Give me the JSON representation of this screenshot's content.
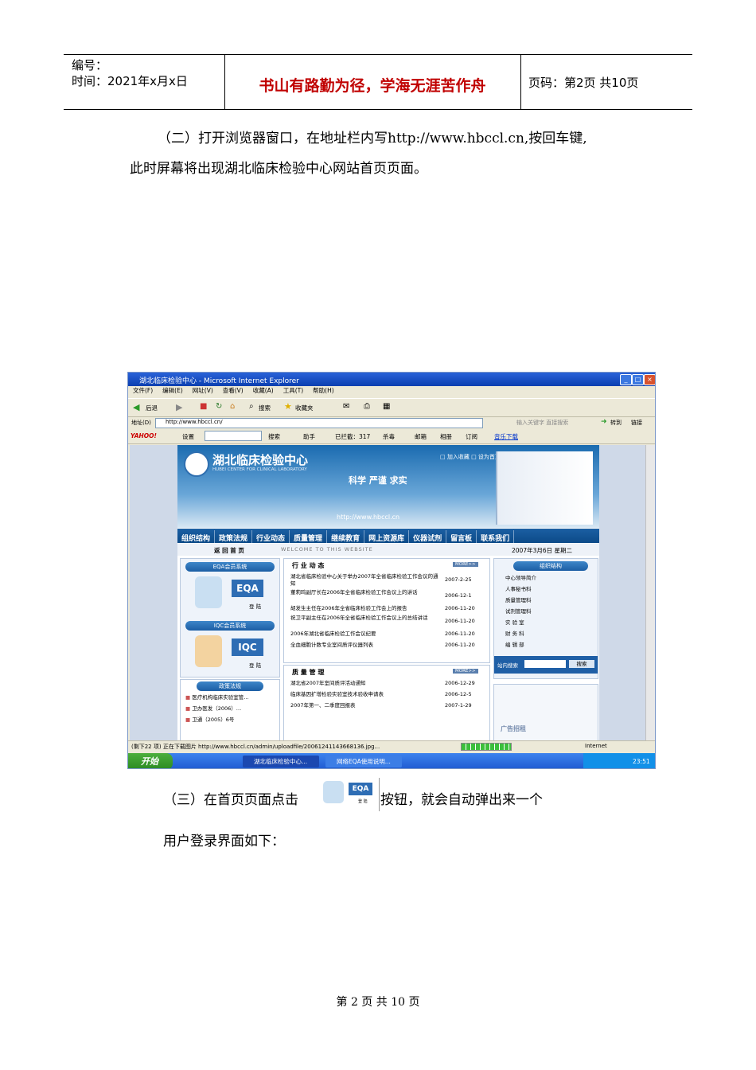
{
  "header": {
    "code_label": "编号：",
    "date_label": "时间：2021年x月x日",
    "motto": "书山有路勤为径，学海无涯苦作舟",
    "page_label": "页码：第2页  共10页"
  },
  "paragraphs": {
    "p1_line1": "（二）打开浏览器窗口，在地址栏内写http://www.hbccl.cn,按回车键,",
    "p1_line2": "此时屏幕将出现湖北临床检验中心网站首页页面。",
    "p2_before": "（三）在首页页面点击",
    "p2_after": "按钮，就会自动弹出来一个",
    "p2_line2": "用户登录界面如下："
  },
  "footer": "第 2 页 共 10 页",
  "screenshot": {
    "window_title": "湖北临床检验中心 - Microsoft Internet Explorer",
    "menu": [
      "文件(F)",
      "编辑(E)",
      "网址(V)",
      "查看(V)",
      "收藏(A)",
      "工具(T)",
      "帮助(H)"
    ],
    "toolbar": {
      "back": "后退",
      "search": "搜索",
      "favorites": "收藏夹"
    },
    "address_label": "地址(D)",
    "address_value": "http://www.hbccl.cn/",
    "address_hint": "输入关键字  直接搜索",
    "go": "转到",
    "links": "链接",
    "yahoo": {
      "logo": "YAHOO!",
      "settings": "设置",
      "search": "搜索",
      "help": "助手",
      "blocked": "已拦截：317",
      "antivirus": "杀毒",
      "mail": "邮箱",
      "photos": "相册",
      "subscribe": "订阅",
      "music": "音乐下载"
    },
    "site": {
      "name": "湖北临床检验中心",
      "name_en": "HUBEI CENTER FOR CLINICAL LABORATORY",
      "top_links": "□ 加入收藏   □ 设为首页",
      "slogan": "科学  严谨  求实",
      "url": "http://www.hbccl.cn",
      "nav": [
        "组织结构",
        "政策法规",
        "行业动态",
        "质量管理",
        "继续教育",
        "网上资源库",
        "仪器试剂",
        "留言板",
        "联系我们"
      ],
      "home": "返 回 首 页",
      "welcome": "WELCOME TO THIS WEBSITE",
      "date": "2007年3月6日 星期二",
      "eqa_title": "EQA会员系统",
      "eqa_badge": "EQA",
      "login": "登 陆",
      "iqc_title": "IQC会员系统",
      "iqc_badge": "IQC",
      "policy_title": "政策法规",
      "policy_items": [
        "医疗机构临床实验室管…",
        "卫办医发（2006）…",
        "卫通（2005）6号"
      ],
      "news_title": "行 业 动 态",
      "more": "MORE>>",
      "news": [
        {
          "t": "湖北省临床检验中心关于举办2007年全省临床检验工作会议的通知",
          "d": "2007-2-25"
        },
        {
          "t": "董莉鸣副厅长在2006年全省临床检验工作会议上的讲话",
          "d": "2006-12-1"
        },
        {
          "t": "胡发生主任在2006年全省临床检验工作会上的报告",
          "d": "2006-11-20"
        },
        {
          "t": "祝卫平副主任在2006年全省临床检验工作会议上的总结讲话",
          "d": "2006-11-20"
        },
        {
          "t": "2006年湖北省临床检验工作会议纪要",
          "d": "2006-11-20"
        },
        {
          "t": "全血细胞计数专业室间质评仪器列表",
          "d": "2006-11-20"
        }
      ],
      "quality_title": "质 量 管 理",
      "quality": [
        {
          "t": "湖北省2007年室间质评活动通知",
          "d": "2006-12-29"
        },
        {
          "t": "临床基因扩增检验实验室技术验收申请表",
          "d": "2006-12-5"
        },
        {
          "t": "2007年第一、二季度回报表",
          "d": "2007-1-29"
        }
      ],
      "org_title": "组织结构",
      "org_items": [
        "中心领导简介",
        "人事秘书科",
        "质量管理科",
        "试剂管理科",
        "实 验 室",
        "财 务 科",
        "编 辑 部"
      ],
      "site_search": "站内搜索",
      "search_btn": "搜索",
      "ad": "广告招租"
    },
    "status_text": "(剩下22 项) 正在下载图片 http://www.hbccl.cn/admin/uploadfile/20061241143668136.jpg...",
    "status_zone": "Internet",
    "start": "开始",
    "tasks": [
      "湖北临床检验中心...",
      "网络EQA使用说明..."
    ],
    "clock": "23:51"
  }
}
